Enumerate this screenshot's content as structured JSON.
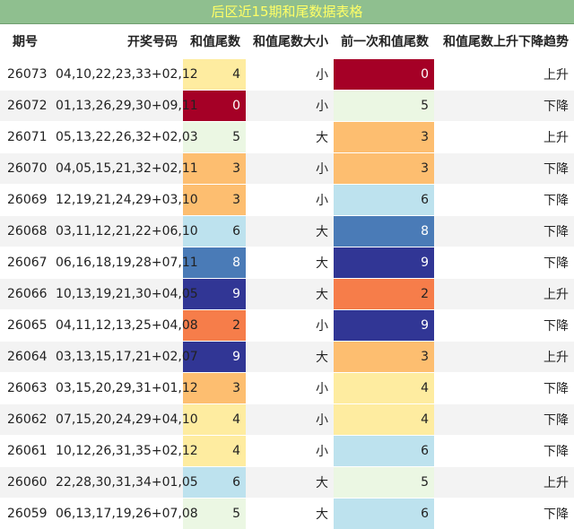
{
  "title": "后区近15期和尾数据表格",
  "headers": [
    "期号",
    "开奖号码",
    "和值尾数",
    "和值尾数大小",
    "前一次和值尾数",
    "和值尾数上升下降趋势"
  ],
  "colors": {
    "0": "#a50026",
    "1": "#d73027",
    "2": "#f67d4a",
    "3": "#fdbe70",
    "4": "#feeca0",
    "5": "#ebf7e3",
    "6": "#bde2ee",
    "7": "#8ac0db",
    "8": "#4a7bb7",
    "9": "#313695"
  },
  "rows": [
    {
      "issue": "26073",
      "numbers": "04,10,22,23,33+02,12",
      "tail": "4",
      "size": "小",
      "prev": "0",
      "trend": "上升"
    },
    {
      "issue": "26072",
      "numbers": "01,13,26,29,30+09,11",
      "tail": "0",
      "size": "小",
      "prev": "5",
      "trend": "下降"
    },
    {
      "issue": "26071",
      "numbers": "05,13,22,26,32+02,03",
      "tail": "5",
      "size": "大",
      "prev": "3",
      "trend": "上升"
    },
    {
      "issue": "26070",
      "numbers": "04,05,15,21,32+02,11",
      "tail": "3",
      "size": "小",
      "prev": "3",
      "trend": "下降"
    },
    {
      "issue": "26069",
      "numbers": "12,19,21,24,29+03,10",
      "tail": "3",
      "size": "小",
      "prev": "6",
      "trend": "下降"
    },
    {
      "issue": "26068",
      "numbers": "03,11,12,21,22+06,10",
      "tail": "6",
      "size": "大",
      "prev": "8",
      "trend": "下降"
    },
    {
      "issue": "26067",
      "numbers": "06,16,18,19,28+07,11",
      "tail": "8",
      "size": "大",
      "prev": "9",
      "trend": "下降"
    },
    {
      "issue": "26066",
      "numbers": "10,13,19,21,30+04,05",
      "tail": "9",
      "size": "大",
      "prev": "2",
      "trend": "上升"
    },
    {
      "issue": "26065",
      "numbers": "04,11,12,13,25+04,08",
      "tail": "2",
      "size": "小",
      "prev": "9",
      "trend": "下降"
    },
    {
      "issue": "26064",
      "numbers": "03,13,15,17,21+02,07",
      "tail": "9",
      "size": "大",
      "prev": "3",
      "trend": "上升"
    },
    {
      "issue": "26063",
      "numbers": "03,15,20,29,31+01,12",
      "tail": "3",
      "size": "小",
      "prev": "4",
      "trend": "下降"
    },
    {
      "issue": "26062",
      "numbers": "07,15,20,24,29+04,10",
      "tail": "4",
      "size": "小",
      "prev": "4",
      "trend": "下降"
    },
    {
      "issue": "26061",
      "numbers": "10,12,26,31,35+02,12",
      "tail": "4",
      "size": "小",
      "prev": "6",
      "trend": "下降"
    },
    {
      "issue": "26060",
      "numbers": "22,28,30,31,34+01,05",
      "tail": "6",
      "size": "大",
      "prev": "5",
      "trend": "上升"
    },
    {
      "issue": "26059",
      "numbers": "06,13,17,19,26+07,08",
      "tail": "5",
      "size": "大",
      "prev": "6",
      "trend": "下降"
    }
  ]
}
